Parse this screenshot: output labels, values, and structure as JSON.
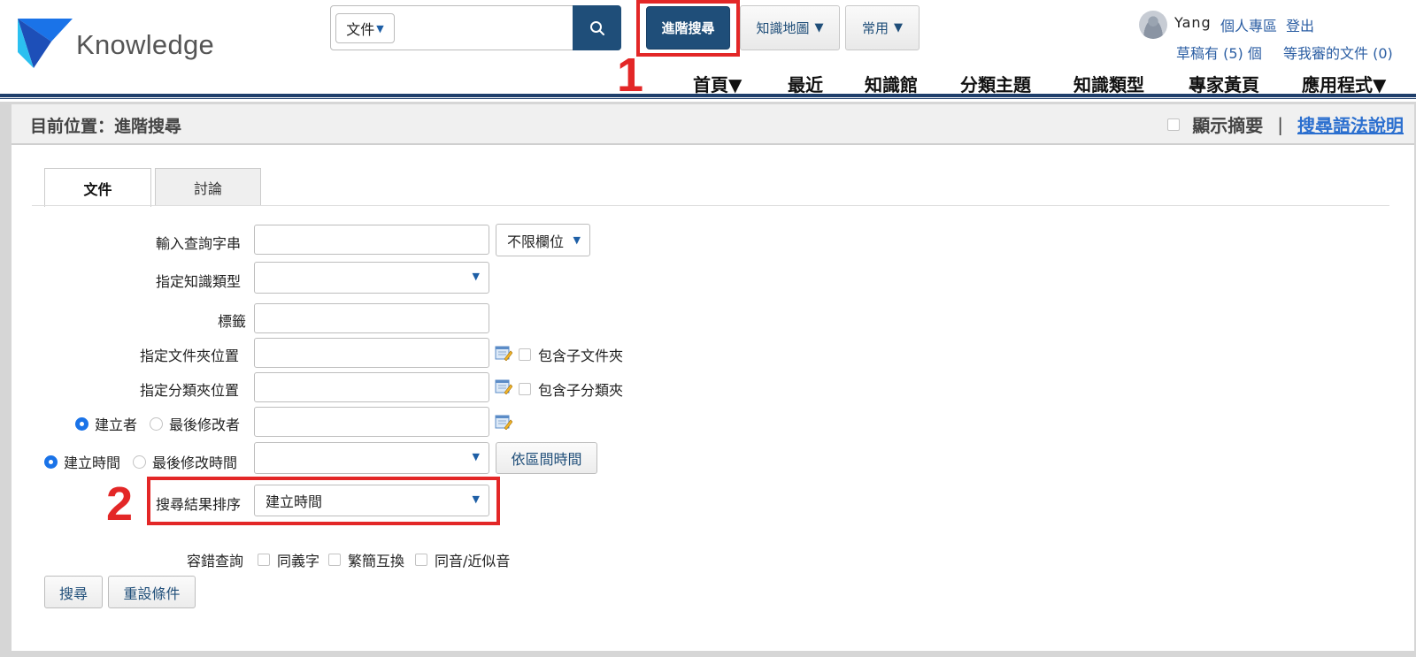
{
  "header": {
    "logo_text": "Knowledge",
    "search": {
      "scope": "文件",
      "value": ""
    },
    "advanced_search_label": "進階搜尋",
    "knowledge_map_label": "知識地圖",
    "common_label": "常用",
    "user": {
      "name": "Yang",
      "personal_area": "個人專區",
      "logout": "登出",
      "drafts": "草稿有 (5) 個",
      "pending_review": "等我審的文件 (0)"
    },
    "nav": [
      "首頁▼",
      "最近",
      "知識館",
      "分類主題",
      "知識類型",
      "專家黃頁",
      "應用程式▼"
    ]
  },
  "markers": {
    "one": "1",
    "two": "2"
  },
  "location": {
    "text": "目前位置：進階搜尋",
    "show_summary": "顯示摘要",
    "separator": "|",
    "syntax_help": "搜尋語法說明"
  },
  "tabs": [
    {
      "label": "文件",
      "active": true
    },
    {
      "label": "討論",
      "active": false
    }
  ],
  "form": {
    "query_label": "輸入查詢字串",
    "query_value": "",
    "field_scope": "不限欄位",
    "knowledge_type_label": "指定知識類型",
    "knowledge_type_value": "",
    "tag_label": "標籤",
    "tag_value": "",
    "folder_label": "指定文件夾位置",
    "folder_value": "",
    "include_subfolders": "包含子文件夾",
    "category_label": "指定分類夾位置",
    "category_value": "",
    "include_subcategories": "包含子分類夾",
    "creator_radio": "建立者",
    "modifier_radio": "最後修改者",
    "person_value": "",
    "created_time_radio": "建立時間",
    "modified_time_radio": "最後修改時間",
    "time_value": "",
    "range_button": "依區間時間",
    "sort_label": "搜尋結果排序",
    "sort_value": "建立時間",
    "fuzzy_label": "容錯查詢",
    "synonym": "同義字",
    "trad_simp": "繁簡互換",
    "homophone": "同音/近似音",
    "search_button": "搜尋",
    "reset_button": "重設條件"
  },
  "colors": {
    "brand_navy": "#1f4e79",
    "link_blue": "#2b5ea3",
    "highlight_red": "#e32727",
    "radio_blue": "#1a73e8"
  }
}
